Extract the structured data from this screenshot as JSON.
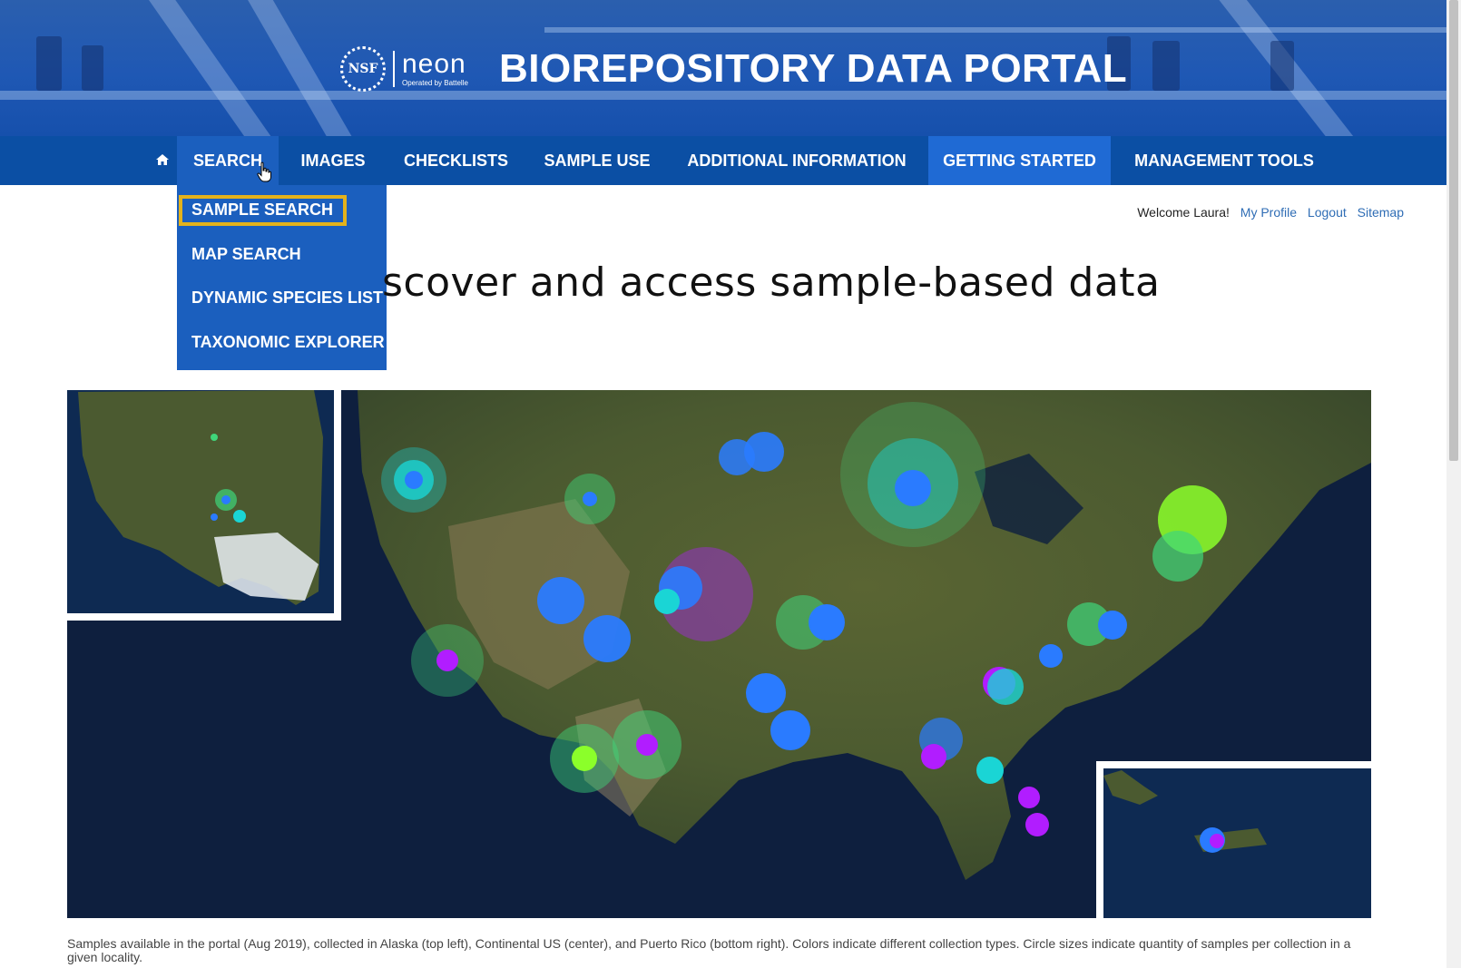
{
  "header": {
    "logo_nsf": "NSF",
    "logo_neon": "neon",
    "logo_operated": "Operated by Battelle",
    "title": "BIOREPOSITORY DATA PORTAL"
  },
  "nav": {
    "home_icon": "home-icon",
    "items": [
      {
        "label": "SEARCH"
      },
      {
        "label": "IMAGES"
      },
      {
        "label": "CHECKLISTS"
      },
      {
        "label": "SAMPLE USE"
      },
      {
        "label": "ADDITIONAL INFORMATION"
      },
      {
        "label": "GETTING STARTED"
      },
      {
        "label": "MANAGEMENT TOOLS"
      }
    ],
    "active": "GETTING STARTED"
  },
  "search_menu": {
    "items": [
      {
        "label": "SAMPLE SEARCH"
      },
      {
        "label": "MAP SEARCH"
      },
      {
        "label": "DYNAMIC SPECIES LIST"
      },
      {
        "label": "TAXONOMIC EXPLORER"
      }
    ],
    "highlighted": "SAMPLE SEARCH"
  },
  "user": {
    "welcome": "Welcome Laura!",
    "links": [
      "My Profile",
      "Logout",
      "Sitemap"
    ]
  },
  "hero": {
    "heading_visible": "scover and access sample-based data"
  },
  "map": {
    "caption": "Samples available in the portal (Aug 2019), collected in Alaska (top left), Continental US (center), and Puerto Rico (bottom right). Colors indicate different collection types. Circle sizes indicate quantity of samples per collection in a given locality.",
    "colors": {
      "blue": "#2a7bff",
      "cyan": "#1ad5d5",
      "green": "#3fd67a",
      "lime": "#8bff2a",
      "purple": "#b11dff",
      "ocean": "#0e1f3e",
      "land": "#4b5a30"
    }
  },
  "colors": {
    "nav_bg": "#0b4fa4",
    "nav_active": "#1f6ad4",
    "dropdown_bg": "#1b5fbe",
    "highlight": "#e3b21c",
    "link": "#2f6db5"
  }
}
